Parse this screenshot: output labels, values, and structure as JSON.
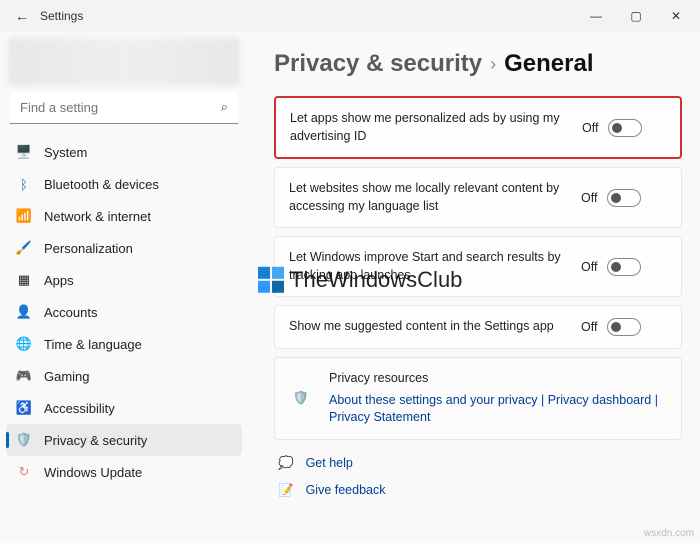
{
  "window": {
    "title": "Settings"
  },
  "search": {
    "placeholder": "Find a setting"
  },
  "sidebar": {
    "items": [
      {
        "label": "System"
      },
      {
        "label": "Bluetooth & devices"
      },
      {
        "label": "Network & internet"
      },
      {
        "label": "Personalization"
      },
      {
        "label": "Apps"
      },
      {
        "label": "Accounts"
      },
      {
        "label": "Time & language"
      },
      {
        "label": "Gaming"
      },
      {
        "label": "Accessibility"
      },
      {
        "label": "Privacy & security"
      },
      {
        "label": "Windows Update"
      }
    ]
  },
  "breadcrumb": {
    "parent": "Privacy & security",
    "current": "General"
  },
  "settings": [
    {
      "label": "Let apps show me personalized ads by using my advertising ID",
      "state": "Off",
      "highlight": true
    },
    {
      "label": "Let websites show me locally relevant content by accessing my language list",
      "state": "Off"
    },
    {
      "label": "Let Windows improve Start and search results by tracking app launches",
      "state": "Off"
    },
    {
      "label": "Show me suggested content in the Settings app",
      "state": "Off"
    }
  ],
  "resources": {
    "title": "Privacy resources",
    "links": [
      "About these settings and your privacy",
      "Privacy dashboard",
      "Privacy Statement"
    ]
  },
  "footer": {
    "help": "Get help",
    "feedback": "Give feedback"
  },
  "watermark": "TheWindowsClub",
  "cornerlink": "wsxdn.com"
}
